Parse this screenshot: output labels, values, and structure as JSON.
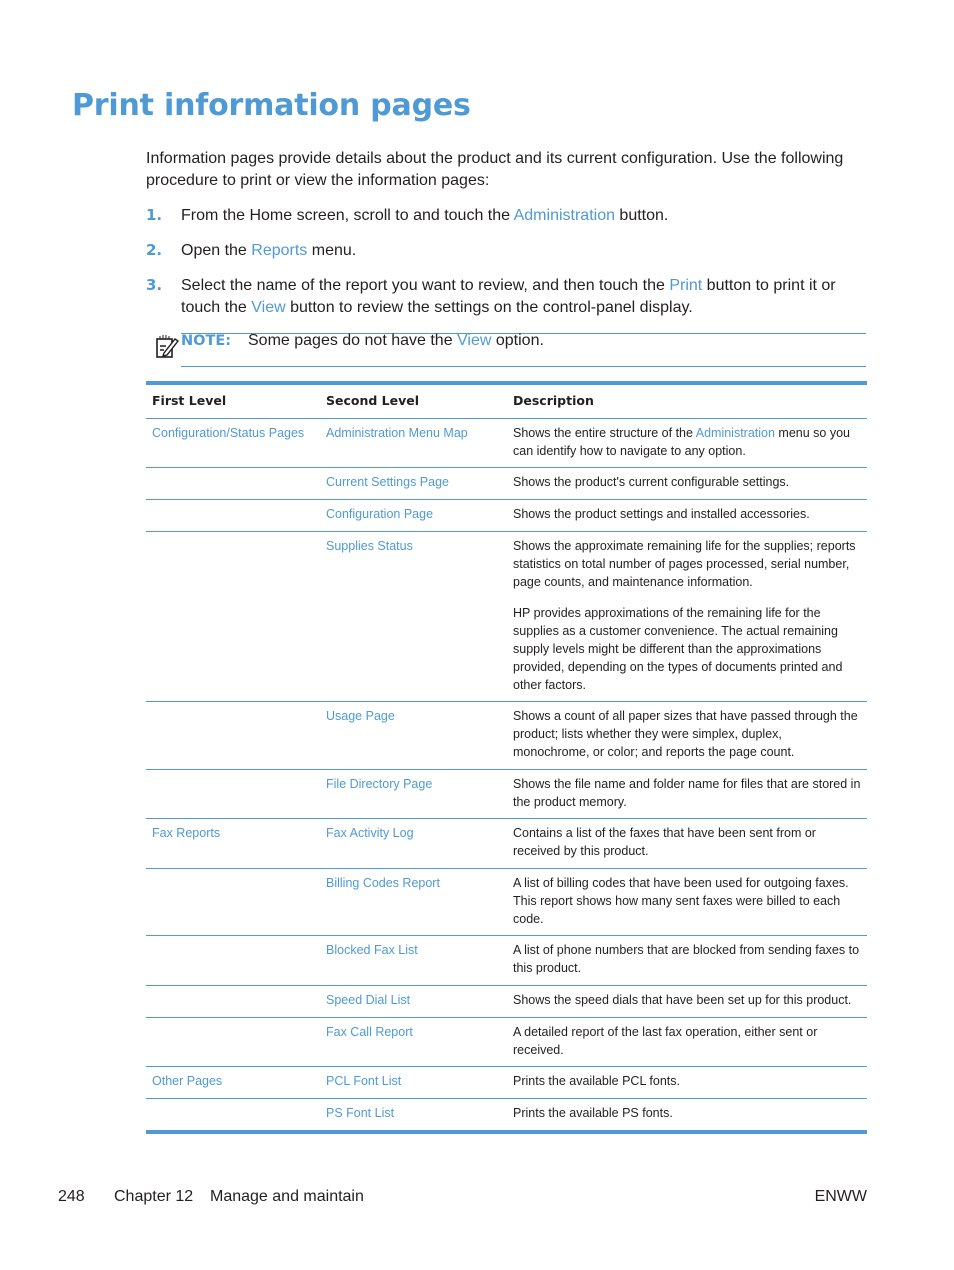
{
  "page_title": "Print information pages",
  "intro": "Information pages provide details about the product and its current configuration. Use the following procedure to print or view the information pages:",
  "steps": [
    {
      "num": "1.",
      "pre": "From the Home screen, scroll to and touch the ",
      "link": "Administration",
      "post": " button."
    },
    {
      "num": "2.",
      "pre": "Open the ",
      "link": "Reports",
      "post": " menu."
    },
    {
      "num": "3.",
      "pre": "Select the name of the report you want to review, and then touch the ",
      "link": "Print",
      "mid": " button to print it or touch the ",
      "link2": "View",
      "post": " button to review the settings on the control-panel display."
    }
  ],
  "note": {
    "icon": "note-pencil-icon",
    "label": "NOTE:",
    "pre": "Some pages do not have the ",
    "link": "View",
    "post": " option."
  },
  "table": {
    "headers": [
      "First Level",
      "Second Level",
      "Description"
    ],
    "rows": [
      {
        "first": "Configuration/Status Pages",
        "second": "Administration Menu Map",
        "desc_pre": "Shows the entire structure of the ",
        "desc_link": "Administration",
        "desc_post": " menu so you can identify how to navigate to any option."
      },
      {
        "first": "",
        "second": "Current Settings Page",
        "desc": "Shows the product's current configurable settings."
      },
      {
        "first": "",
        "second": "Configuration Page",
        "desc": "Shows the product settings and installed accessories."
      },
      {
        "first": "",
        "second": "Supplies Status",
        "desc": "Shows the approximate remaining life for the supplies; reports statistics on total number of pages processed, serial number, page counts, and maintenance information.",
        "desc2": "HP provides approximations of the remaining life for the supplies as a customer convenience. The actual remaining supply levels might be different than the approximations provided, depending on the types of documents printed and other factors."
      },
      {
        "first": "",
        "second": "Usage Page",
        "desc": "Shows a count of all paper sizes that have passed through the product; lists whether they were simplex, duplex, monochrome, or color; and reports the page count."
      },
      {
        "first": "",
        "second": "File Directory Page",
        "desc": "Shows the file name and folder name for files that are stored in the product memory."
      },
      {
        "first": "Fax Reports",
        "second": "Fax Activity Log",
        "desc": "Contains a list of the faxes that have been sent from or received by this product."
      },
      {
        "first": "",
        "second": "Billing Codes Report",
        "desc": "A list of billing codes that have been used for outgoing faxes. This report shows how many sent faxes were billed to each code."
      },
      {
        "first": "",
        "second": "Blocked Fax List",
        "desc": "A list of phone numbers that are blocked from sending faxes to this product."
      },
      {
        "first": "",
        "second": "Speed Dial List",
        "desc": "Shows the speed dials that have been set up for this product."
      },
      {
        "first": "",
        "second": "Fax Call Report",
        "desc": "A detailed report of the last fax operation, either sent or received."
      },
      {
        "first": "Other Pages",
        "second": "PCL Font List",
        "desc": "Prints the available PCL fonts."
      },
      {
        "first": "",
        "second": "PS Font List",
        "desc": "Prints the available PS fonts."
      }
    ]
  },
  "footer": {
    "page_number": "248",
    "chapter": "Chapter 12",
    "chapter_title": "Manage and maintain",
    "right": "ENWW"
  },
  "colors": {
    "accent": "#4f9ad4",
    "text": "#231f20"
  }
}
